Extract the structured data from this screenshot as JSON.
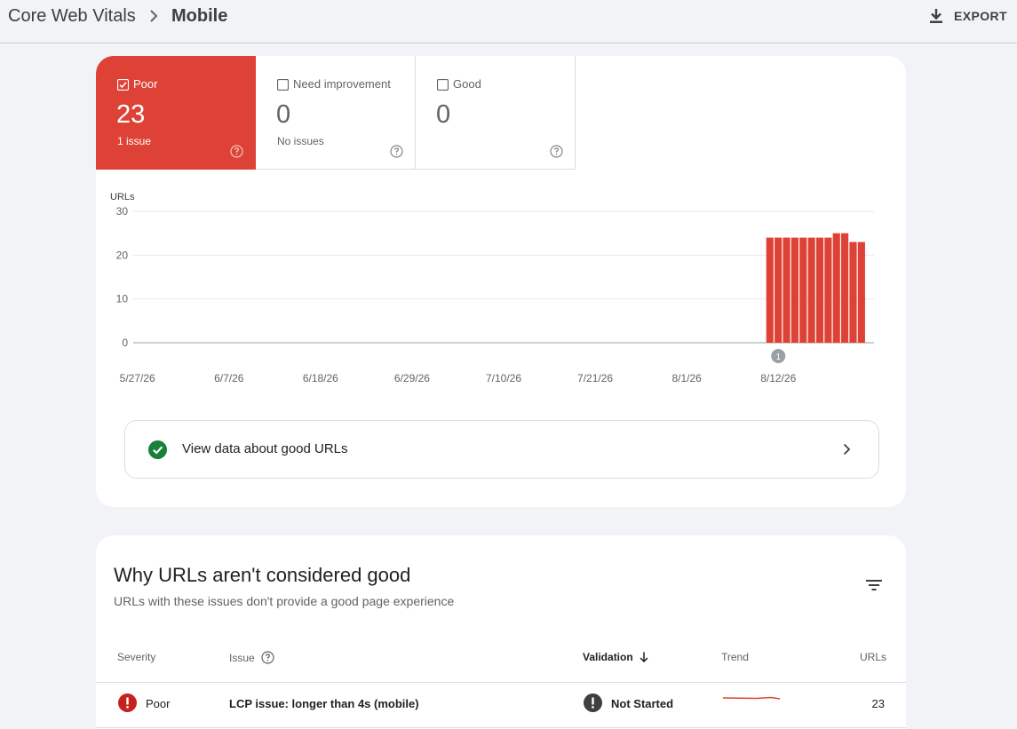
{
  "breadcrumb": {
    "root": "Core Web Vitals",
    "current": "Mobile"
  },
  "header": {
    "export_label": "EXPORT"
  },
  "tiles": [
    {
      "label": "Poor",
      "count": "23",
      "sub": "1 issue",
      "checked": true
    },
    {
      "label": "Need improvement",
      "count": "0",
      "sub": "No issues",
      "checked": false
    },
    {
      "label": "Good",
      "count": "0",
      "sub": "",
      "checked": false
    }
  ],
  "chart_data": {
    "type": "bar",
    "ylabel": "URLs",
    "ylim": [
      0,
      30
    ],
    "yticks": [
      0,
      10,
      20,
      30
    ],
    "xlim": [
      "5/27/26",
      "8/23/26"
    ],
    "xtick_labels": [
      "5/27/26",
      "6/7/26",
      "6/18/26",
      "6/29/26",
      "7/10/26",
      "7/21/26",
      "8/1/26",
      "8/12/26"
    ],
    "grid": true,
    "color": "#de4236",
    "series": [
      {
        "x": [
          "8/11/26",
          "8/12/26",
          "8/13/26",
          "8/14/26",
          "8/15/26",
          "8/16/26",
          "8/17/26",
          "8/18/26",
          "8/19/26",
          "8/20/26",
          "8/21/26",
          "8/22/26"
        ],
        "values": [
          24,
          24,
          24,
          24,
          24,
          24,
          24,
          24,
          25,
          25,
          23,
          23
        ]
      }
    ],
    "annotations": [
      {
        "x": "8/12/26",
        "label": "1"
      }
    ]
  },
  "good_urls_link": {
    "label": "View data about good URLs"
  },
  "issues_card": {
    "title": "Why URLs aren't considered good",
    "subtitle": "URLs with these issues don't provide a good page experience",
    "columns": {
      "severity": "Severity",
      "issue": "Issue",
      "validation": "Validation",
      "trend": "Trend",
      "urls": "URLs"
    },
    "rows": [
      {
        "severity": "Poor",
        "issue": "LCP issue: longer than 4s (mobile)",
        "validation": "Not Started",
        "urls": "23"
      }
    ]
  },
  "colors": {
    "poor": "#de4236",
    "good": "#188038",
    "neutral_icon": "#3c4043"
  }
}
